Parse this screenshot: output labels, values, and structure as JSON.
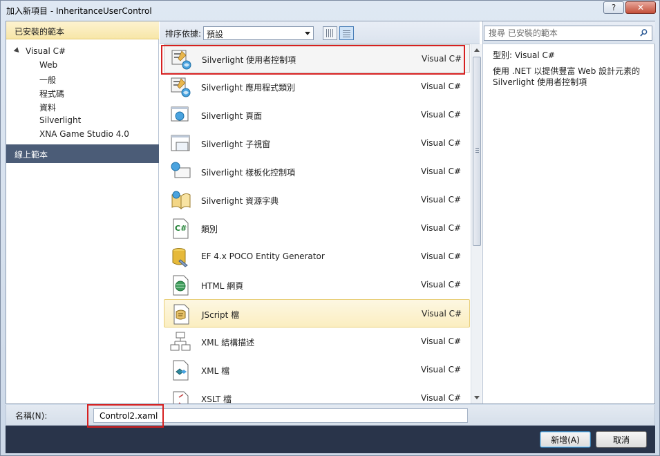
{
  "window": {
    "title": "加入新項目 - InheritanceUserControl",
    "help_label": "?",
    "close_label": "✕"
  },
  "left": {
    "header": "已安裝的範本",
    "tree": [
      {
        "label": "Visual C#",
        "level": 0
      },
      {
        "label": "Web",
        "level": 1
      },
      {
        "label": "一般",
        "level": 1
      },
      {
        "label": "程式碼",
        "level": 1
      },
      {
        "label": "資料",
        "level": 1
      },
      {
        "label": "Silverlight",
        "level": 1
      },
      {
        "label": "XNA Game Studio 4.0",
        "level": 1
      }
    ],
    "online": "線上範本"
  },
  "toolbar": {
    "sort_label": "排序依據:",
    "sort_value": "預設"
  },
  "search": {
    "placeholder": "搜尋 已安裝的範本"
  },
  "templates": [
    {
      "name": "Silverlight 使用者控制項",
      "lang": "Visual C#",
      "icon": "silverlight-usercontrol-icon"
    },
    {
      "name": "Silverlight 應用程式類別",
      "lang": "Visual C#",
      "icon": "silverlight-app-class-icon"
    },
    {
      "name": "Silverlight 頁面",
      "lang": "Visual C#",
      "icon": "silverlight-page-icon"
    },
    {
      "name": "Silverlight 子視窗",
      "lang": "Visual C#",
      "icon": "silverlight-child-window-icon"
    },
    {
      "name": "Silverlight 樣板化控制項",
      "lang": "Visual C#",
      "icon": "silverlight-templated-control-icon"
    },
    {
      "name": "Silverlight 資源字典",
      "lang": "Visual C#",
      "icon": "silverlight-resource-dictionary-icon"
    },
    {
      "name": "類別",
      "lang": "Visual C#",
      "icon": "csharp-class-icon"
    },
    {
      "name": "EF 4.x POCO Entity Generator",
      "lang": "Visual C#",
      "icon": "database-generator-icon"
    },
    {
      "name": "HTML 網頁",
      "lang": "Visual C#",
      "icon": "html-page-icon"
    },
    {
      "name": "JScript 檔",
      "lang": "Visual C#",
      "icon": "jscript-file-icon"
    },
    {
      "name": "XML 結構描述",
      "lang": "Visual C#",
      "icon": "xml-schema-icon"
    },
    {
      "name": "XML 檔",
      "lang": "Visual C#",
      "icon": "xml-file-icon"
    },
    {
      "name": "XSLT 檔",
      "lang": "Visual C#",
      "icon": "xslt-file-icon"
    }
  ],
  "details": {
    "type_line": "型別:  Visual C#",
    "description": "使用 .NET 以提供豐富 Web 設計元素的 Silverlight 使用者控制項"
  },
  "bottom": {
    "name_label": "名稱(N):",
    "name_value": "Control2.xaml",
    "ok_label": "新增(A)",
    "cancel_label": "取消"
  },
  "colors": {
    "accent_red": "#d62020",
    "footer_bg": "#29344a",
    "online_bg": "#4b5c77",
    "hover_bg": "#fbeec1"
  }
}
